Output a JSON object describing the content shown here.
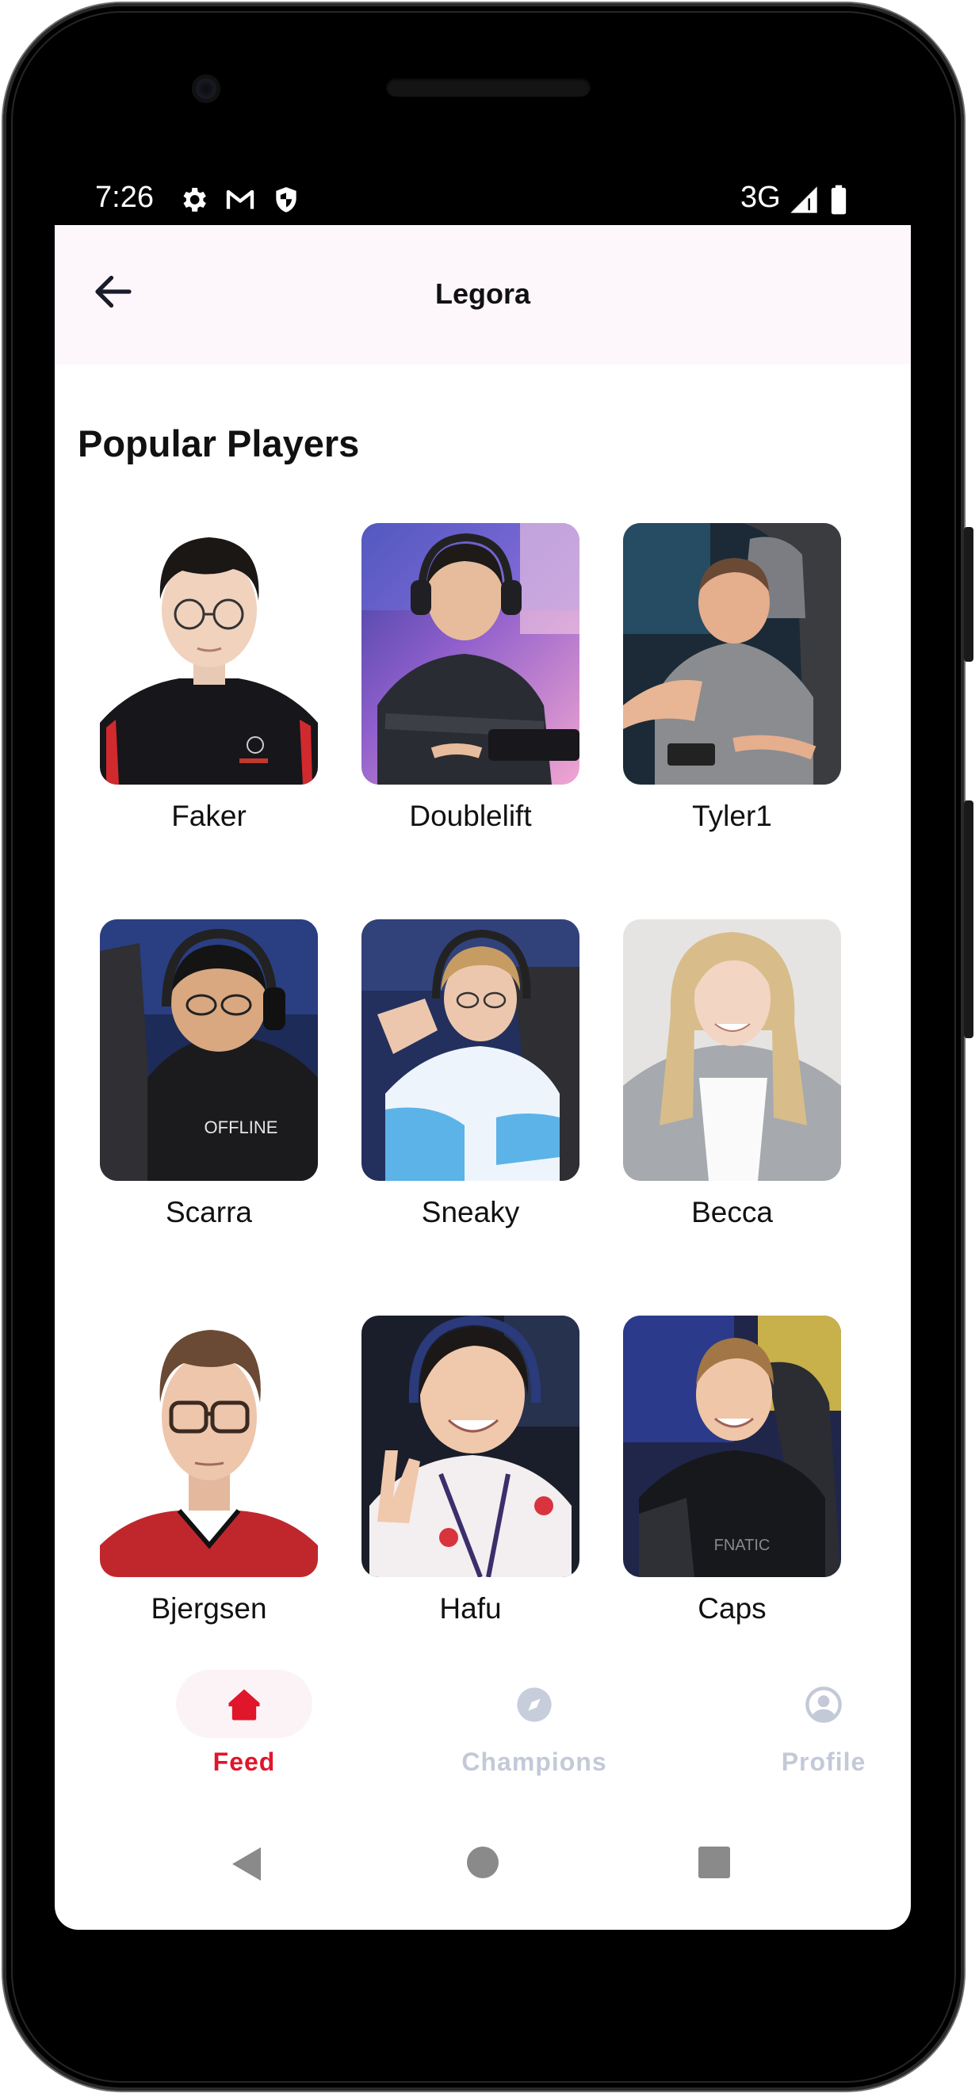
{
  "status_bar": {
    "time": "7:26",
    "network": "3G",
    "icons": [
      "gear-icon",
      "gmail-icon",
      "shield-icon",
      "signal-icon",
      "battery-icon"
    ]
  },
  "app_bar": {
    "title": "Legora",
    "back_icon": "arrow-left-icon"
  },
  "section": {
    "title": "Popular Players"
  },
  "players": [
    {
      "name": "Faker"
    },
    {
      "name": "Doublelift"
    },
    {
      "name": "Tyler1"
    },
    {
      "name": "Scarra"
    },
    {
      "name": "Sneaky"
    },
    {
      "name": "Becca"
    },
    {
      "name": "Bjergsen"
    },
    {
      "name": "Hafu"
    },
    {
      "name": "Caps"
    }
  ],
  "bottom_nav": {
    "items": [
      {
        "label": "Feed",
        "icon": "home-icon",
        "active": true
      },
      {
        "label": "Champions",
        "icon": "compass-icon",
        "active": false
      },
      {
        "label": "Profile",
        "icon": "account-circle-icon",
        "active": false
      }
    ]
  },
  "colors": {
    "accent": "#e0162b",
    "inactive": "#bcc3d4",
    "app_bar_bg": "#fdf7fc",
    "active_pill": "#fcf3f7"
  },
  "system_nav": [
    "back-triangle-icon",
    "home-circle-icon",
    "recents-square-icon"
  ]
}
